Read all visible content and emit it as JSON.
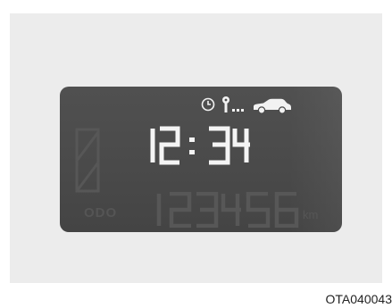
{
  "display": {
    "time": "12:34",
    "odometer": "123456",
    "odo_label": "ODO",
    "distance_unit": "km"
  },
  "icons": {
    "clock": "clock-icon",
    "key": "key-icon",
    "car": "car-icon",
    "fuel_gauge": "fuel-gauge-icon"
  },
  "caption": {
    "figure_code": "OTA040043"
  },
  "colors": {
    "background": "#ececec",
    "lcd_background": "#4a4a4a",
    "lit_segment": "#f4f4f4",
    "ghost_segment": "#575757"
  }
}
